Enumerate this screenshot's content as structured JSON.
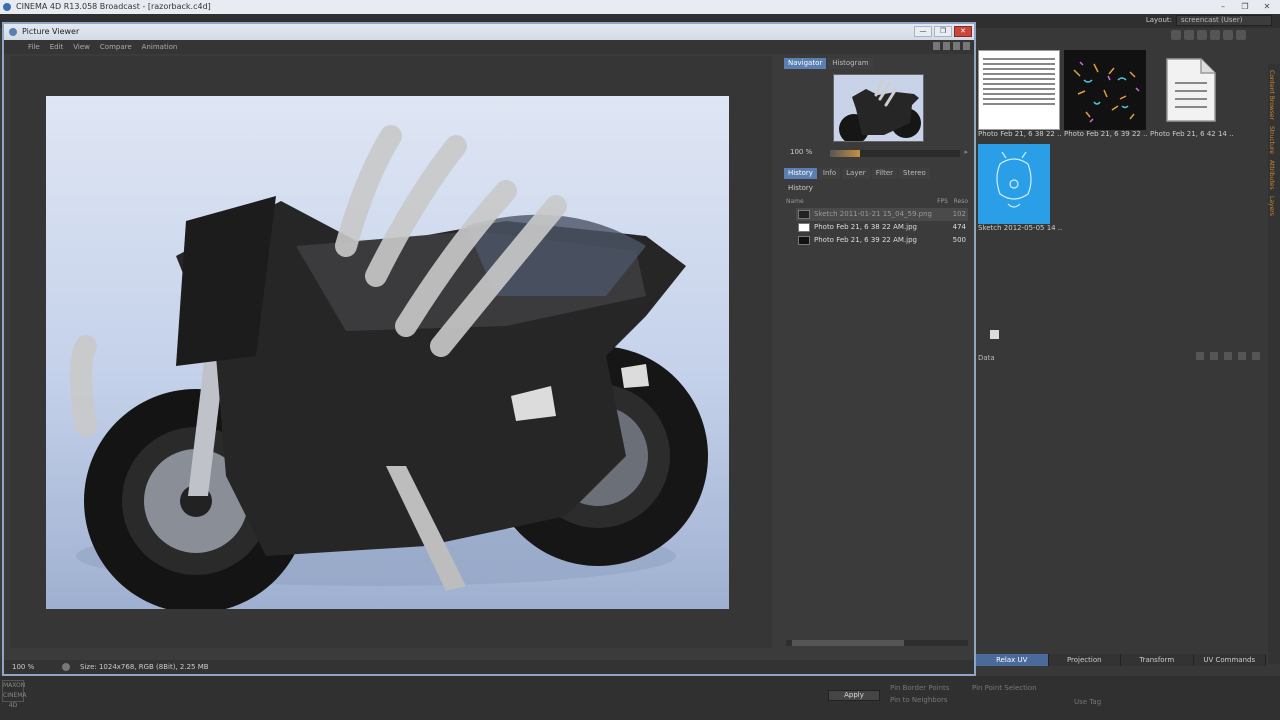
{
  "app": {
    "title": "CINEMA 4D R13.058 Broadcast - [razorback.c4d]",
    "controls": [
      "–",
      "❐",
      "✕"
    ],
    "layout_label": "Layout:",
    "layout_value": "screencast (User)"
  },
  "picture_viewer": {
    "title": "Picture Viewer",
    "window_controls": [
      "—",
      "❐",
      "✕"
    ],
    "menu": [
      "File",
      "Edit",
      "View",
      "Compare",
      "Animation"
    ],
    "navigator_tabs": [
      "Navigator",
      "Histogram"
    ],
    "active_nav_tab": "Navigator",
    "zoom": "100 %",
    "zoom_fill_fraction": 0.23,
    "history_tabs": [
      "History",
      "Info",
      "Layer",
      "Filter",
      "Stereo"
    ],
    "active_history_tab": "History",
    "history_label": "History",
    "history_columns": {
      "name": "Name",
      "fps": "FPS",
      "res": "Reso"
    },
    "history_rows": [
      {
        "name": "Sketch 2011-01-21 15_04_59.png",
        "res": "102",
        "selected": true
      },
      {
        "name": "Photo Feb 21, 6 38 22 AM.jpg",
        "res": "474",
        "selected": false
      },
      {
        "name": "Photo Feb 21, 6 39 22 AM.jpg",
        "res": "500",
        "selected": false
      }
    ],
    "status_zoom": "100 %",
    "status_size": "Size: 1024x768, RGB (8Bit), 2.25 MB"
  },
  "content_browser": {
    "thumbnails": [
      {
        "caption": "Photo Feb 21, 6 38 22 ...",
        "icon": "document-thumbnail"
      },
      {
        "caption": "Photo Feb 21, 6 39 22 ...",
        "icon": "dark-sketch-thumbnail"
      },
      {
        "caption": "Photo Feb 21, 6 42 14 ...",
        "icon": "file-icon"
      },
      {
        "caption": "Sketch 2012-05-05 14 ...",
        "icon": "blue-sketch-thumbnail"
      }
    ],
    "side_tabs": [
      "Content Browser",
      "Structure",
      "Attributes",
      "Layers"
    ],
    "data_label": "Data"
  },
  "uv_tabs": [
    "Relax UV",
    "Projection",
    "Transform",
    "UV Commands"
  ],
  "active_uv_tab": "Relax UV",
  "bottom_options": {
    "pin_border": "Pin Border Points",
    "pin_neighbors": "Pin to Neighbors",
    "pin_selection": "Pin Point Selection",
    "use_tag": "Use Tag",
    "apply": "Apply",
    "logo_text": "MAXON CINEMA 4D"
  }
}
